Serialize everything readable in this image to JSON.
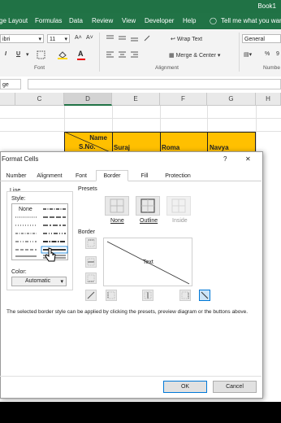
{
  "window": {
    "title": "Book1"
  },
  "ribbon_tabs": [
    "ge Layout",
    "Formulas",
    "Data",
    "Review",
    "View",
    "Developer",
    "Help",
    "Tell me what you want"
  ],
  "ribbon": {
    "font_name": "ibri",
    "font_size": "11",
    "grow_font": "A˄",
    "shrink_font": "A˅",
    "italic": "I",
    "underline": "U",
    "font_color": "A",
    "wrap_text": "Wrap Text",
    "merge_center": "Merge & Center",
    "number_format": "General",
    "percent": "%",
    "comma": "9",
    "group_font": "Font",
    "group_alignment": "Alignment",
    "group_number": "Numbe"
  },
  "columns": [
    "C",
    "D",
    "E",
    "F",
    "G",
    "H"
  ],
  "cells": {
    "d_header_top": "Name",
    "d_header_bottom": "S.No.",
    "e": "Suraj",
    "f": "Roma",
    "g": "Navya"
  },
  "dialog": {
    "title": "Format Cells",
    "help": "?",
    "close": "✕",
    "tabs": [
      "Number",
      "Alignment",
      "Font",
      "Border",
      "Fill",
      "Protection"
    ],
    "active_tab": "Border",
    "line_label": "Line",
    "style_label": "Style:",
    "style_none": "None",
    "color_label": "Color:",
    "color_value": "Automatic",
    "presets_label": "Presets",
    "preset_none": "None",
    "preset_outline": "Outline",
    "preset_inside": "Inside",
    "border_label": "Border",
    "preview_text": "Text",
    "info": "The selected border style can be applied by clicking the presets, preview diagram or the buttons above.",
    "ok": "OK",
    "cancel": "Cancel"
  },
  "colors": {
    "excel_green": "#217346",
    "header_fill": "#ffc000",
    "active_tab": "#ffffff"
  }
}
